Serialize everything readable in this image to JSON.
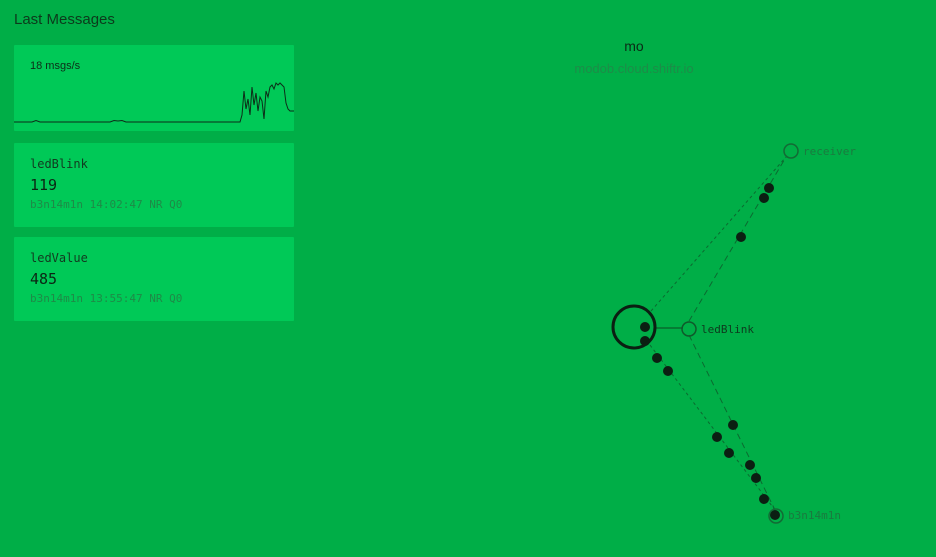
{
  "sidebar": {
    "title": "Last Messages",
    "rate": {
      "label": "18 msgs/s"
    },
    "messages": [
      {
        "topic": "ledBlink",
        "payload": "119",
        "meta": "b3n14m1n 14:02:47 NR Q0"
      },
      {
        "topic": "ledValue",
        "payload": "485",
        "meta": "b3n14m1n 13:55:47 NR Q0"
      }
    ]
  },
  "broker": {
    "name": "mo",
    "host": "modob.cloud.shiftr.io"
  },
  "graph": {
    "nodes": {
      "receiver": "receiver",
      "ledblink": "ledBlink",
      "client": "b3n14m1n"
    }
  },
  "colors": {
    "background": "#00ae47",
    "card": "#00c957",
    "ink": "#0b2614",
    "muted": "#1d8c48"
  }
}
